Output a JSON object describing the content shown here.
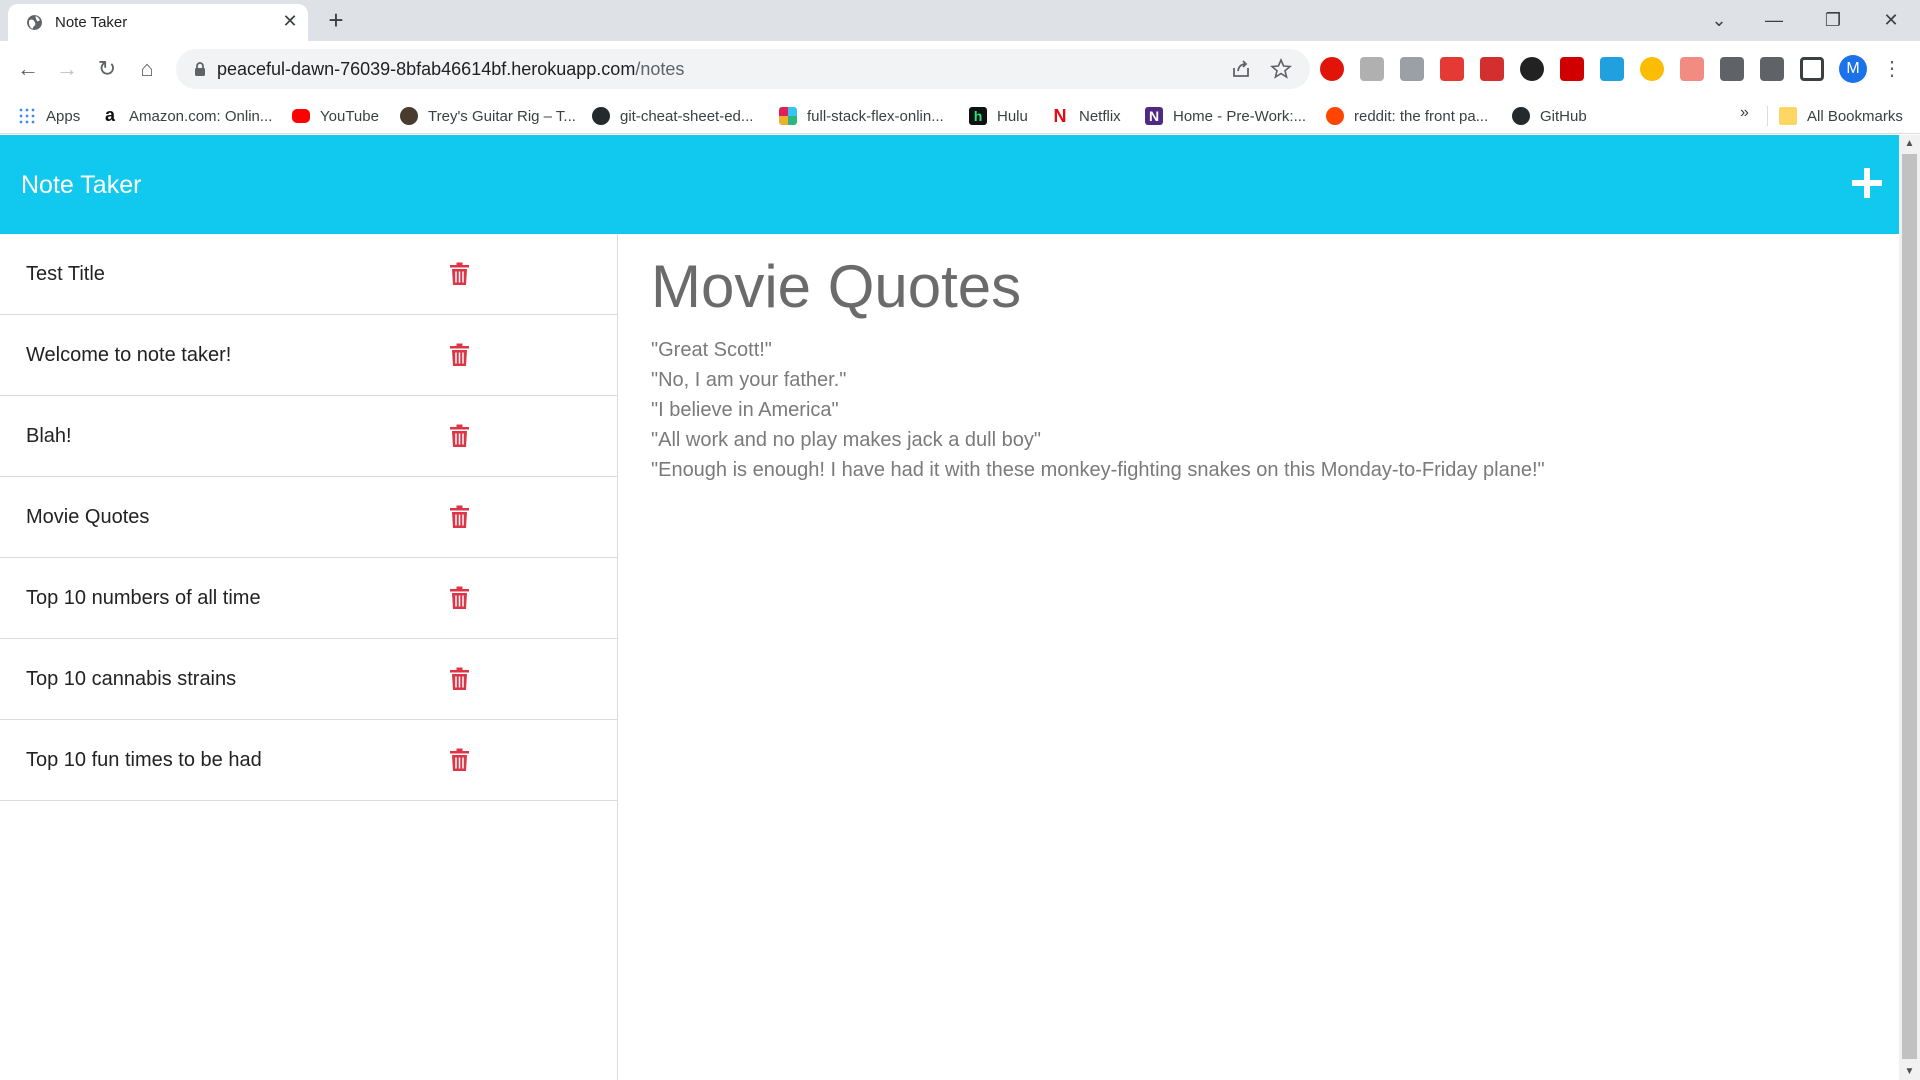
{
  "browser": {
    "tab_title": "Note Taker",
    "tab_close": "✕",
    "new_tab": "+",
    "url_host": "peaceful-dawn-76039-8bfab46614bf.herokuapp.com",
    "url_path": "/notes",
    "profile_initial": "M",
    "window_controls": {
      "dropdown": "⌄",
      "minimize": "—",
      "restore": "❐",
      "close": "✕"
    },
    "bookmarks": [
      {
        "label": "Apps",
        "icon": "apps-grid-icon",
        "color": "#4285f4"
      },
      {
        "label": "Amazon.com: Onlin...",
        "icon": "amazon-icon",
        "color": "#111111"
      },
      {
        "label": "YouTube",
        "icon": "youtube-icon",
        "color": "#ff0000"
      },
      {
        "label": "Trey's Guitar Rig – T...",
        "icon": "guitar-rig-icon",
        "color": "#4a3b2f"
      },
      {
        "label": "git-cheat-sheet-ed...",
        "icon": "github-icon",
        "color": "#24292e"
      },
      {
        "label": "full-stack-flex-onlin...",
        "icon": "slack-icon",
        "color": "#e01e5a"
      },
      {
        "label": "Hulu",
        "icon": "hulu-icon",
        "color": "#111111"
      },
      {
        "label": "Netflix",
        "icon": "netflix-icon",
        "color": "#e50914"
      },
      {
        "label": "Home - Pre-Work:...",
        "icon": "northwestern-icon",
        "color": "#4e2a84"
      },
      {
        "label": "reddit: the front pa...",
        "icon": "reddit-icon",
        "color": "#ff4500"
      },
      {
        "label": "GitHub",
        "icon": "github-icon",
        "color": "#24292e"
      }
    ],
    "bookmarks_overflow": "»",
    "all_bookmarks": "All Bookmarks"
  },
  "app": {
    "title": "Note Taker",
    "header_color": "#11c9ee",
    "delete_color": "#dc3545",
    "notes": [
      {
        "title": "Test Title"
      },
      {
        "title": "Welcome to note taker!"
      },
      {
        "title": "Blah!"
      },
      {
        "title": "Movie Quotes"
      },
      {
        "title": "Top 10 numbers of all time"
      },
      {
        "title": "Top 10 cannabis strains"
      },
      {
        "title": "Top 10 fun times to be had"
      }
    ],
    "active_note": {
      "title": "Movie Quotes",
      "lines": [
        "\"Great Scott!\"",
        "\"No, I am your father.\"",
        "\"I believe in America\"",
        "\"All work and no play makes jack a dull boy\"",
        "\"Enough is enough! I have had it with these monkey-fighting snakes on this Monday-to-Friday plane!\""
      ]
    }
  }
}
